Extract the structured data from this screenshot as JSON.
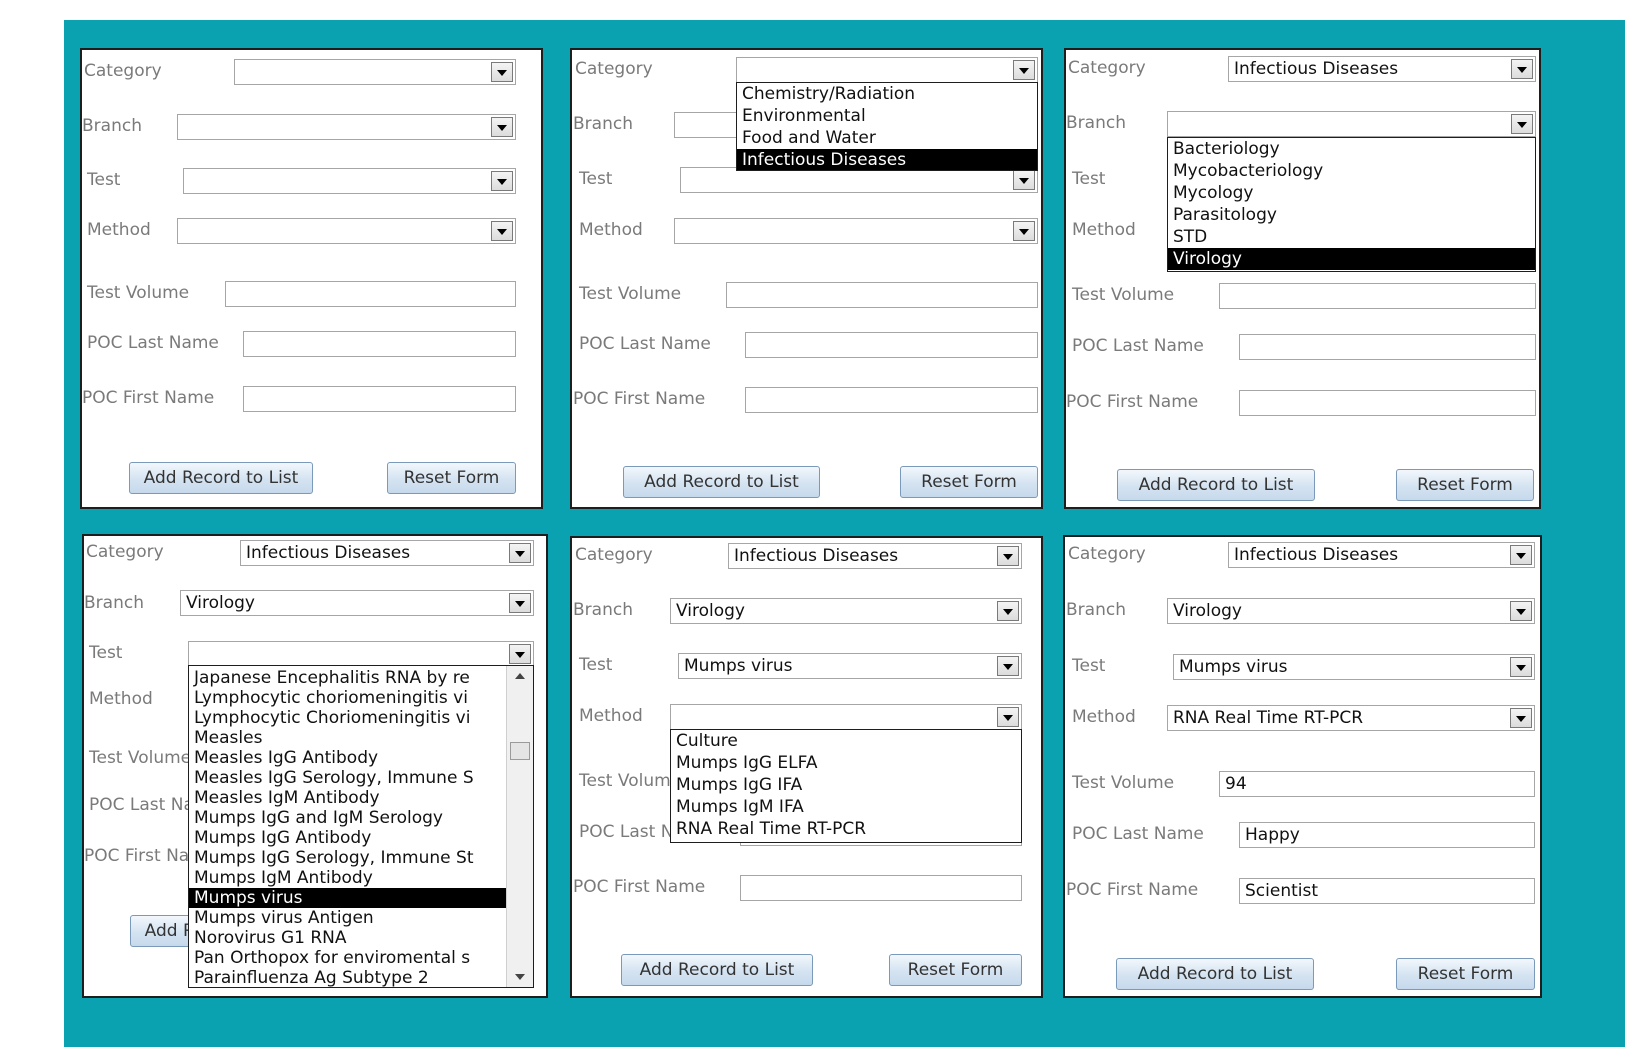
{
  "labels": {
    "category": "Category",
    "branch": "Branch",
    "test": "Test",
    "method": "Method",
    "test_volume": "Test Volume",
    "poc_last": "POC Last Name",
    "poc_first": "POC First Name",
    "add_record": "Add Record to List",
    "reset_form": "Reset Form"
  },
  "panels": [
    {
      "category": "",
      "branch": "",
      "test": "",
      "method": "",
      "test_volume": "",
      "poc_last": "",
      "poc_first": ""
    },
    {
      "category": "",
      "branch": "",
      "test": "",
      "method": "",
      "test_volume": "",
      "poc_last": "",
      "poc_first": "",
      "dropdown": {
        "field": "category",
        "items": [
          "Chemistry/Radiation",
          "Environmental",
          "Food and Water",
          "Infectious Diseases"
        ],
        "selected": "Infectious Diseases"
      }
    },
    {
      "category": "Infectious Diseases",
      "branch": "",
      "test": "",
      "method": "",
      "test_volume": "",
      "poc_last": "",
      "poc_first": "",
      "dropdown": {
        "field": "branch",
        "items": [
          "Bacteriology",
          "Mycobacteriology",
          "Mycology",
          "Parasitology",
          "STD",
          "Virology"
        ],
        "selected": "Virology"
      }
    },
    {
      "category": "Infectious Diseases",
      "branch": "Virology",
      "test": "",
      "method": "",
      "test_volume": "",
      "poc_last": "",
      "poc_first": "",
      "dropdown": {
        "field": "test",
        "items": [
          "Japanese Encephalitis RNA by re",
          "Lymphocytic choriomeningitis vi",
          "Lymphocytic Choriomeningitis vi",
          "Measles",
          "Measles IgG Antibody",
          "Measles IgG Serology, Immune S",
          "Measles IgM Antibody",
          "Mumps IgG and IgM Serology",
          "Mumps IgG Antibody",
          "Mumps IgG Serology, Immune St",
          "Mumps IgM Antibody",
          "Mumps virus",
          "Mumps virus Antigen",
          "Norovirus G1 RNA",
          "Pan Orthopox for enviromental s",
          "Parainfluenza  Ag Subtype 2"
        ],
        "selected": "Mumps virus"
      }
    },
    {
      "category": "Infectious Diseases",
      "branch": "Virology",
      "test": "Mumps virus",
      "method": "",
      "test_volume": "",
      "poc_last": "",
      "poc_first": "",
      "dropdown": {
        "field": "method",
        "items": [
          "Culture",
          "Mumps IgG ELFA",
          "Mumps IgG IFA",
          "Mumps IgM IFA",
          "RNA Real Time RT-PCR"
        ],
        "selected": ""
      }
    },
    {
      "category": "Infectious Diseases",
      "branch": "Virology",
      "test": "Mumps virus",
      "method": "RNA Real Time RT-PCR",
      "test_volume": "94",
      "poc_last": "Happy",
      "poc_first": "Scientist"
    }
  ],
  "colors": {
    "background": "#0aa1b1",
    "selection": "#000000",
    "label": "#7a7a7a",
    "button_border": "#7b99b8"
  }
}
